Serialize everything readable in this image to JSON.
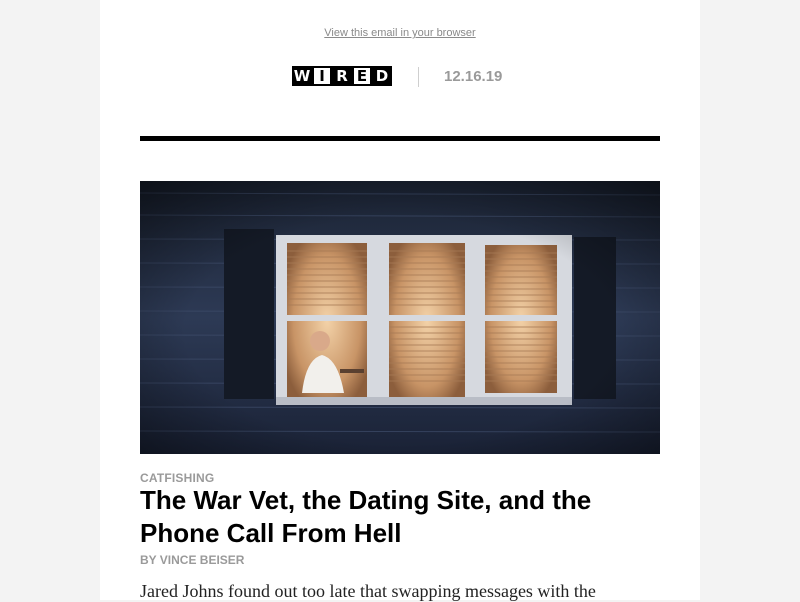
{
  "email": {
    "view_in_browser": "View this email in your browser",
    "brand": {
      "logo_letters": [
        "W",
        "I",
        "R",
        "E",
        "D"
      ],
      "logo_text": "WIRED"
    },
    "date": "12.16.19",
    "article": {
      "hero_image": "photo of a man seated at a desk, seen at night through a lit window of a house with blinds and dark shutters",
      "kicker": "CATFISHING",
      "headline": "The War Vet, the Dating Site, and the Phone Call From Hell",
      "byline": "BY VINCE BEISER",
      "excerpt": "Jared Johns found out too late that swapping messages with the"
    },
    "colors": {
      "page_bg": "#f3f3f3",
      "card_bg": "#ffffff",
      "rule": "#000000",
      "muted": "#9a9a9a"
    }
  }
}
